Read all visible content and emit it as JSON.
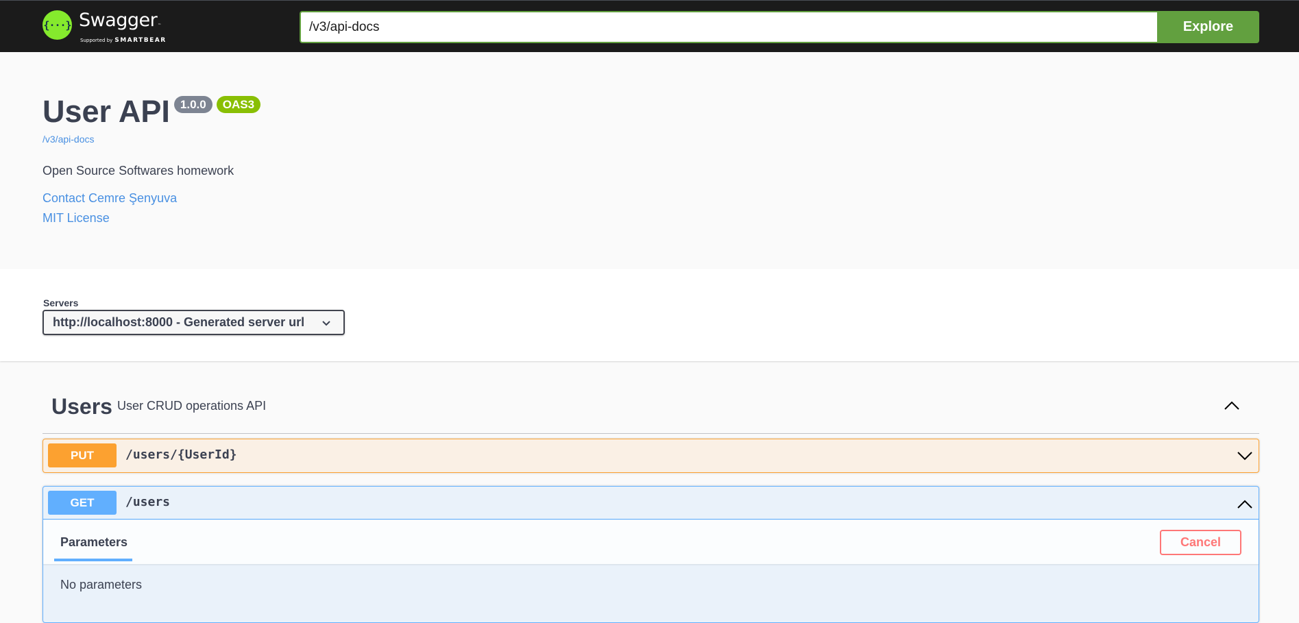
{
  "topbar": {
    "brand": "Swagger",
    "brand_tm": "™",
    "supported_by": "Supported by",
    "supporter": "SMARTBEAR",
    "logo_glyph": "{···}",
    "url_value": "/v3/api-docs",
    "explore_label": "Explore"
  },
  "info": {
    "title": "User API",
    "version": "1.0.0",
    "oas_badge": "OAS3",
    "spec_link": "/v3/api-docs",
    "description": "Open Source Softwares homework",
    "contact": "Contact Cemre Şenyuva",
    "license": "MIT License"
  },
  "servers": {
    "label": "Servers",
    "selected": "http://localhost:8000 - Generated server url"
  },
  "tag": {
    "name": "Users",
    "description": "User CRUD operations API",
    "expanded": true
  },
  "operations": [
    {
      "method": "PUT",
      "path": "/users/{UserId}",
      "expanded": false
    },
    {
      "method": "GET",
      "path": "/users",
      "expanded": true
    }
  ],
  "get_panel": {
    "tab_label": "Parameters",
    "cancel_label": "Cancel",
    "no_params": "No parameters"
  },
  "colors": {
    "put": "#fca130",
    "get": "#61affe",
    "explore": "#62a03f",
    "cancel": "#ff6060",
    "link": "#4990e2"
  }
}
